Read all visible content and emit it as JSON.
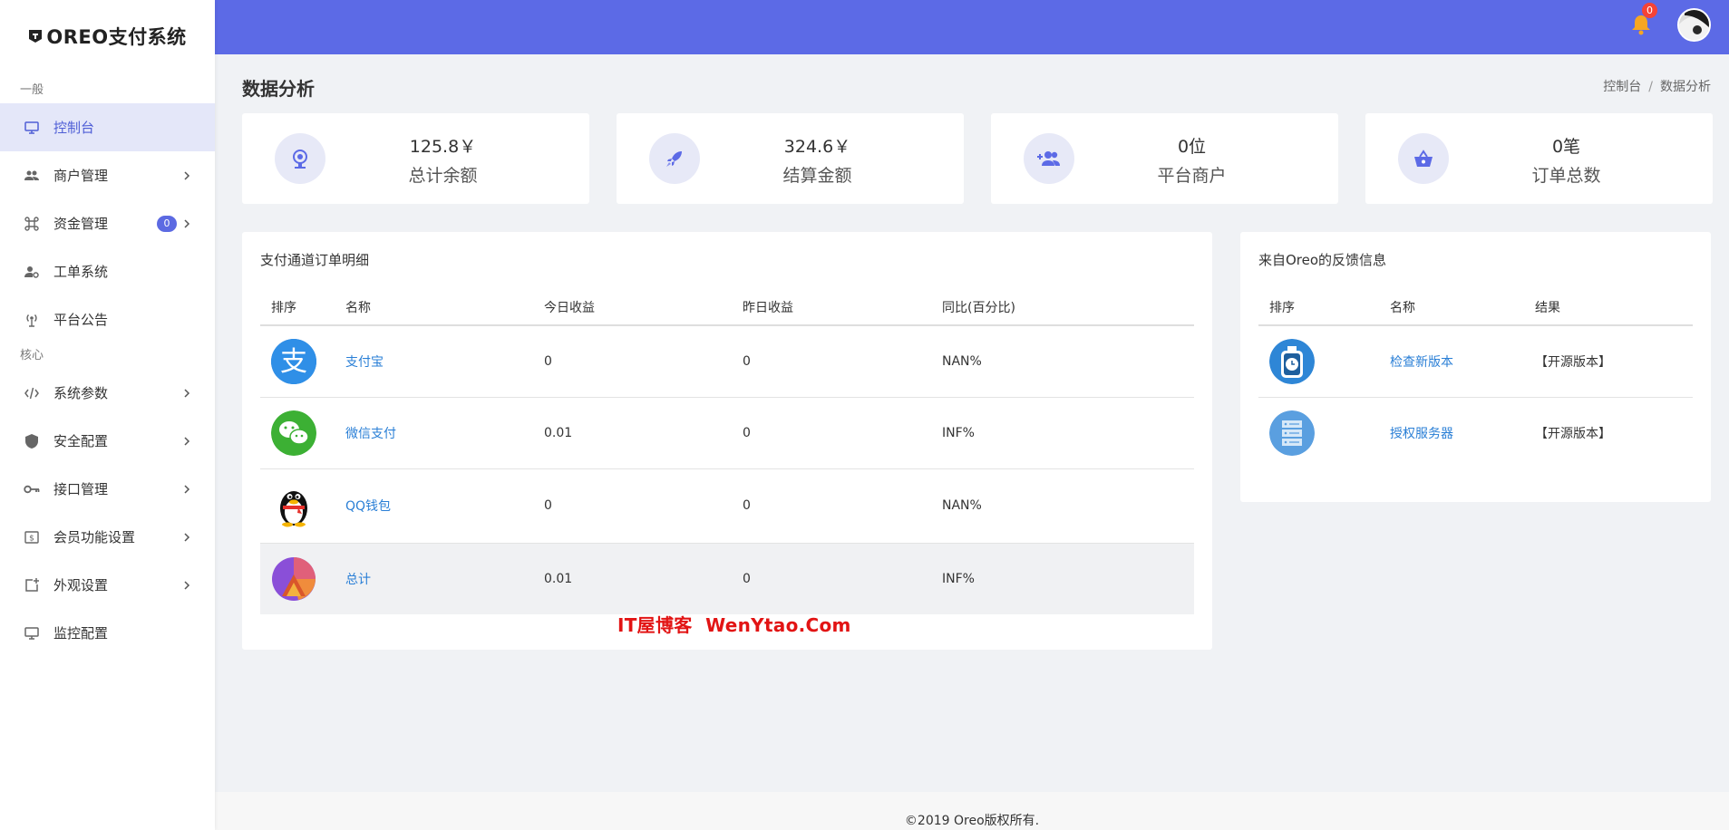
{
  "brand": {
    "name": "OREO支付系统"
  },
  "sidebar": {
    "section_general": "一般",
    "section_core": "核心",
    "items": [
      {
        "label": "控制台",
        "icon": "monitor-icon",
        "active": true
      },
      {
        "label": "商户管理",
        "icon": "users-icon"
      },
      {
        "label": "资金管理",
        "icon": "command-icon",
        "badge": "0"
      },
      {
        "label": "工单系统",
        "icon": "user-gear-icon"
      },
      {
        "label": "平台公告",
        "icon": "broadcast-icon"
      },
      {
        "label": "系统参数",
        "icon": "code-icon"
      },
      {
        "label": "安全配置",
        "icon": "shield-icon"
      },
      {
        "label": "接口管理",
        "icon": "key-icon"
      },
      {
        "label": "会员功能设置",
        "icon": "dollar-box-icon"
      },
      {
        "label": "外观设置",
        "icon": "add-box-icon"
      },
      {
        "label": "监控配置",
        "icon": "monitor-icon"
      }
    ]
  },
  "topbar": {
    "notification_count": "0",
    "accent": "#5c6ae6"
  },
  "page": {
    "title": "数据分析",
    "breadcrumb": [
      "控制台",
      "/",
      "数据分析"
    ]
  },
  "stats": [
    {
      "value": "125.8￥",
      "label": "总计余额",
      "icon": "webcam-icon"
    },
    {
      "value": "324.6￥",
      "label": "结算金额",
      "icon": "rocket-icon"
    },
    {
      "value": "0位",
      "label": "平台商户",
      "icon": "user-add-icon"
    },
    {
      "value": "0笔",
      "label": "订单总数",
      "icon": "basket-icon"
    }
  ],
  "orders": {
    "title": "支付通道订单明细",
    "headers": [
      "排序",
      "名称",
      "今日收益",
      "昨日收益",
      "同比(百分比)"
    ],
    "rows": [
      {
        "name": "支付宝",
        "today": "0",
        "yesterday": "0",
        "ratio": "NAN%",
        "icon": "alipay-icon"
      },
      {
        "name": "微信支付",
        "today": "0.01",
        "yesterday": "0",
        "ratio": "INF%",
        "icon": "wechat-icon"
      },
      {
        "name": "QQ钱包",
        "today": "0",
        "yesterday": "0",
        "ratio": "NAN%",
        "icon": "qq-penguin-icon"
      },
      {
        "name": "总计",
        "today": "0.01",
        "yesterday": "0",
        "ratio": "INF%",
        "icon": "pie-chart-icon"
      }
    ]
  },
  "feedback": {
    "title": "来自Oreo的反馈信息",
    "headers": [
      "排序",
      "名称",
      "结果"
    ],
    "rows": [
      {
        "name": "检查新版本",
        "result": "【开源版本】",
        "icon": "stopwatch-icon"
      },
      {
        "name": "授权服务器",
        "result": "【开源版本】",
        "icon": "server-icon"
      }
    ]
  },
  "watermark": "IT屋博客  WenYtao.Com",
  "footer": "©2019 Oreo版权所有."
}
